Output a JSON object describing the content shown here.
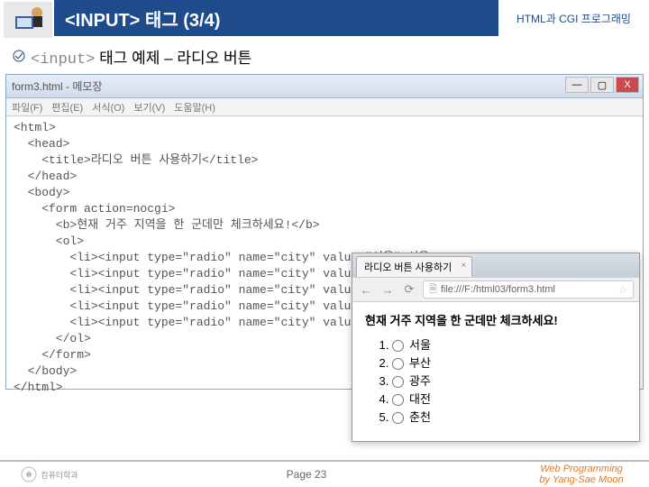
{
  "header": {
    "title": "<INPUT> 태그 (3/4)",
    "course": "HTML과 CGI 프로그래밍"
  },
  "subtitle": {
    "codePart": "<input>",
    "rest": " 태그 예제 – 라디오 버튼"
  },
  "editor": {
    "title": "form3.html - 메모장",
    "menu": [
      "파일(F)",
      "편집(E)",
      "서식(O)",
      "보기(V)",
      "도움말(H)"
    ],
    "btn": {
      "min": "—",
      "max": "▢",
      "close": "X"
    },
    "code": "<html>\n  <head>\n    <title>라디오 버튼 사용하기</title>\n  </head>\n  <body>\n    <form action=nocgi>\n      <b>현재 거주 지역을 한 군데만 체크하세요!</b>\n      <ol>\n        <li><input type=\"radio\" name=\"city\" value=\"서울\">서울\n        <li><input type=\"radio\" name=\"city\" value=\"부산\">부산\n        <li><input type=\"radio\" name=\"city\" value=\"광주\">광주\n        <li><input type=\"radio\" name=\"city\" value=\"대전\">대전\n        <li><input type=\"radio\" name=\"city\" value=\"춘천\">춘천\n      </ol>\n    </form>\n  </body>\n</html>"
  },
  "browser": {
    "tabTitle": "라디오 버튼 사용하기",
    "url": "file:///F:/html03/form3.html",
    "heading": "현재 거주 지역을 한 군데만 체크하세요!",
    "nav": {
      "back": "←",
      "fwd": "→",
      "reload": "⟳"
    },
    "items": [
      "서울",
      "부산",
      "광주",
      "대전",
      "춘천"
    ]
  },
  "footer": {
    "logoText": "컴퓨터학과",
    "page": "Page 23",
    "book": "Web Programming",
    "author": "by Yang-Sae Moon"
  }
}
